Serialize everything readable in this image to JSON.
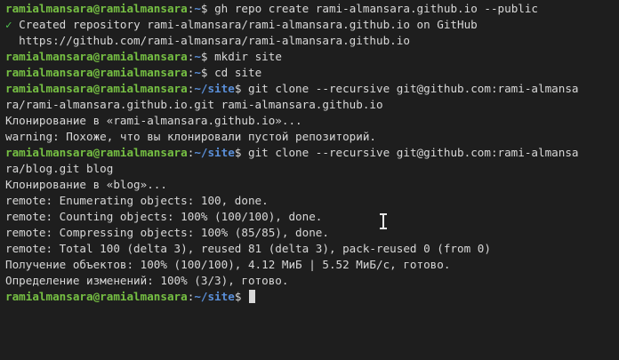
{
  "terminal": {
    "prompt_user": "ramialmansara@ramialmansara",
    "home_path": "~",
    "site_path": "~/site",
    "prompt_colon": ":",
    "prompt_dollar": "$ ",
    "cmd1": "gh repo create rami-almansara.github.io --public",
    "check_mark": "✓",
    "out1": " Created repository rami-almansara/rami-almansara.github.io on GitHub",
    "out2": "  https://github.com/rami-almansara/rami-almansara.github.io",
    "cmd2": "mkdir site",
    "cmd3": "cd site",
    "cmd4_a": "git clone --recursive git@github.com:rami-almansa",
    "cmd4_b": "ra/rami-almansara.github.io.git rami-almansara.github.io",
    "out3": "Клонирование в «rami-almansara.github.io»...",
    "out4": "warning: Похоже, что вы клонировали пустой репозиторий.",
    "cmd5_a": "git clone --recursive git@github.com:rami-almansa",
    "cmd5_b": "ra/blog.git blog",
    "out5": "Клонирование в «blog»...",
    "out6": "remote: Enumerating objects: 100, done.",
    "out7": "remote: Counting objects: 100% (100/100), done.",
    "out8": "remote: Compressing objects: 100% (85/85), done.",
    "out9": "remote: Total 100 (delta 3), reused 81 (delta 3), pack-reused 0 (from 0)",
    "out10": "Получение объектов: 100% (100/100), 4.12 МиБ | 5.52 МиБ/с, готово.",
    "out11": "Определение изменений: 100% (3/3), готово."
  },
  "colors": {
    "background": "#1e1e1e",
    "user": "#76c043",
    "path": "#5a8fd8",
    "text": "#d8d8d8",
    "check": "#4fc24f"
  },
  "icons": {
    "mouse_cursor": "text-ibeam-icon"
  }
}
